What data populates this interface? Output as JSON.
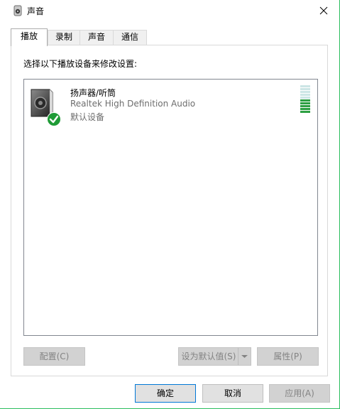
{
  "window": {
    "title": "声音"
  },
  "tabs": [
    {
      "label": "播放",
      "active": true
    },
    {
      "label": "录制",
      "active": false
    },
    {
      "label": "声音",
      "active": false
    },
    {
      "label": "通信",
      "active": false
    }
  ],
  "panel": {
    "instruction": "选择以下播放设备来修改设置:",
    "devices": [
      {
        "name": "扬声器/听筒",
        "driver": "Realtek High Definition Audio",
        "status": "默认设备",
        "icon": "speaker-icon",
        "status_icon": "check-icon",
        "meter": {
          "segments_total": 10,
          "segments_active": 5
        }
      }
    ],
    "buttons": {
      "configure": "配置(C)",
      "set_default": "设为默认值(S)",
      "properties": "属性(P)"
    }
  },
  "footer": {
    "ok": "确定",
    "cancel": "取消",
    "apply": "应用(A)"
  },
  "colors": {
    "accent_border": "#2bbd5f",
    "primary_button_border": "#0078d7",
    "meter_active": "#2ea043",
    "meter_inactive": "#cde6e6",
    "check_green": "#1e9b36"
  }
}
